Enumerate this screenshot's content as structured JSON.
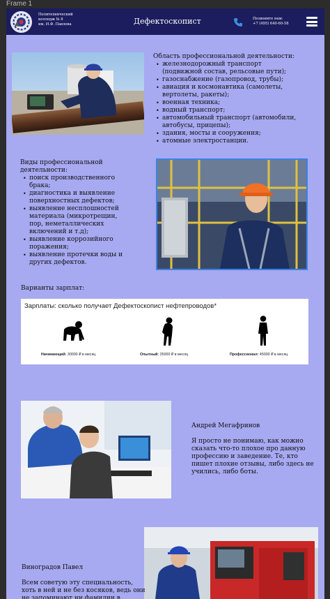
{
  "frame_label": "Frame 1",
  "header": {
    "college_lines": [
      "Политехнический",
      "колледж № 8",
      "им. И.Ф. Павлова"
    ],
    "title": "Дефектоскопист",
    "call_label": "Позвоните нам:",
    "phone": "+7 (495) 640-60-58",
    "icons": [
      "college-logo-icon",
      "phone-icon",
      "menu-icon"
    ]
  },
  "areas": {
    "heading": "Область профессиональной деятельности:",
    "items": [
      "железнодорожный транспорт (подвижной состав, рельсовые пути);",
      "газоснабжение (газопровод, трубы);",
      "авиация и космонавтика (самолеты, вертолеты, ракеты);",
      "военная техника;",
      "водный транспорт;",
      "автомобильный транспорт (автомобили, автобусы, прицепы);",
      "здания, мосты и сооружения;",
      "атомные электростанции."
    ]
  },
  "activities": {
    "heading": "Виды профессиональной деятельности:",
    "items": [
      "поиск производственного брака;",
      "диагностика и выявление поверхностных дефектов;",
      "выявление несплошностей материала (микротрещин, пор, неметаллических включений и т.д);",
      "выявление коррозийного поражения;",
      "выявление протечки воды и других дефектов."
    ]
  },
  "salaries": {
    "heading": "Варианты зарплат:",
    "card_title": "Зарплаты: сколько получает Дефектоскопист нефтепроводов*",
    "levels": [
      {
        "label": "Начинающий:",
        "value": "30000 ₽ в месяц"
      },
      {
        "label": "Опытный:",
        "value": "35000 ₽ в месяц"
      },
      {
        "label": "Профессионал:",
        "value": "45000 ₽ в месяц"
      }
    ]
  },
  "reviews": [
    {
      "name": "Андрей Мегафринов",
      "text": "Я просто не понимаю, как можно сказать что-то плохое про данную профессию и заведение. Те, кто пишет плохие отзывы, либо здесь не учились, либо боты."
    },
    {
      "name": "Виноградов Павел",
      "text": "Всем советую эту специальность, хоть в ней и не без косяков, ведь они не запоминают ни фамилии в"
    }
  ],
  "colors": {
    "page_background": "#a7a9f1",
    "header_background": "#1c1d5e",
    "photo_frame": "#3b82e6"
  }
}
